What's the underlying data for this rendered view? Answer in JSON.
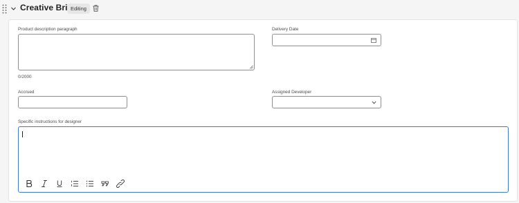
{
  "header": {
    "title": "Creative Brief",
    "status_badge": "Editing"
  },
  "form": {
    "product_description": {
      "label": "Product description paragraph",
      "value": "",
      "counter": "0/2000"
    },
    "delivery_date": {
      "label": "Delivery Date",
      "value": ""
    },
    "accrued": {
      "label": "Accrued",
      "value": ""
    },
    "assigned_developer": {
      "label": "Assigned Developer",
      "value": ""
    },
    "designer_instructions": {
      "label": "Specific instructions for designer",
      "value": ""
    }
  },
  "icons": {
    "drag": "drag-handle-icon",
    "collapse": "chevron-down-icon",
    "delete": "trash-icon",
    "calendar": "calendar-icon",
    "dropdown": "chevron-down-icon",
    "toolbar": [
      "bold-icon",
      "italic-icon",
      "underline-icon",
      "numbered-list-icon",
      "bulleted-list-icon",
      "quote-icon",
      "link-icon"
    ]
  },
  "colors": {
    "focus_border": "#3b78c8",
    "field_border": "#8e8e8e",
    "background": "#f5f5f5"
  }
}
